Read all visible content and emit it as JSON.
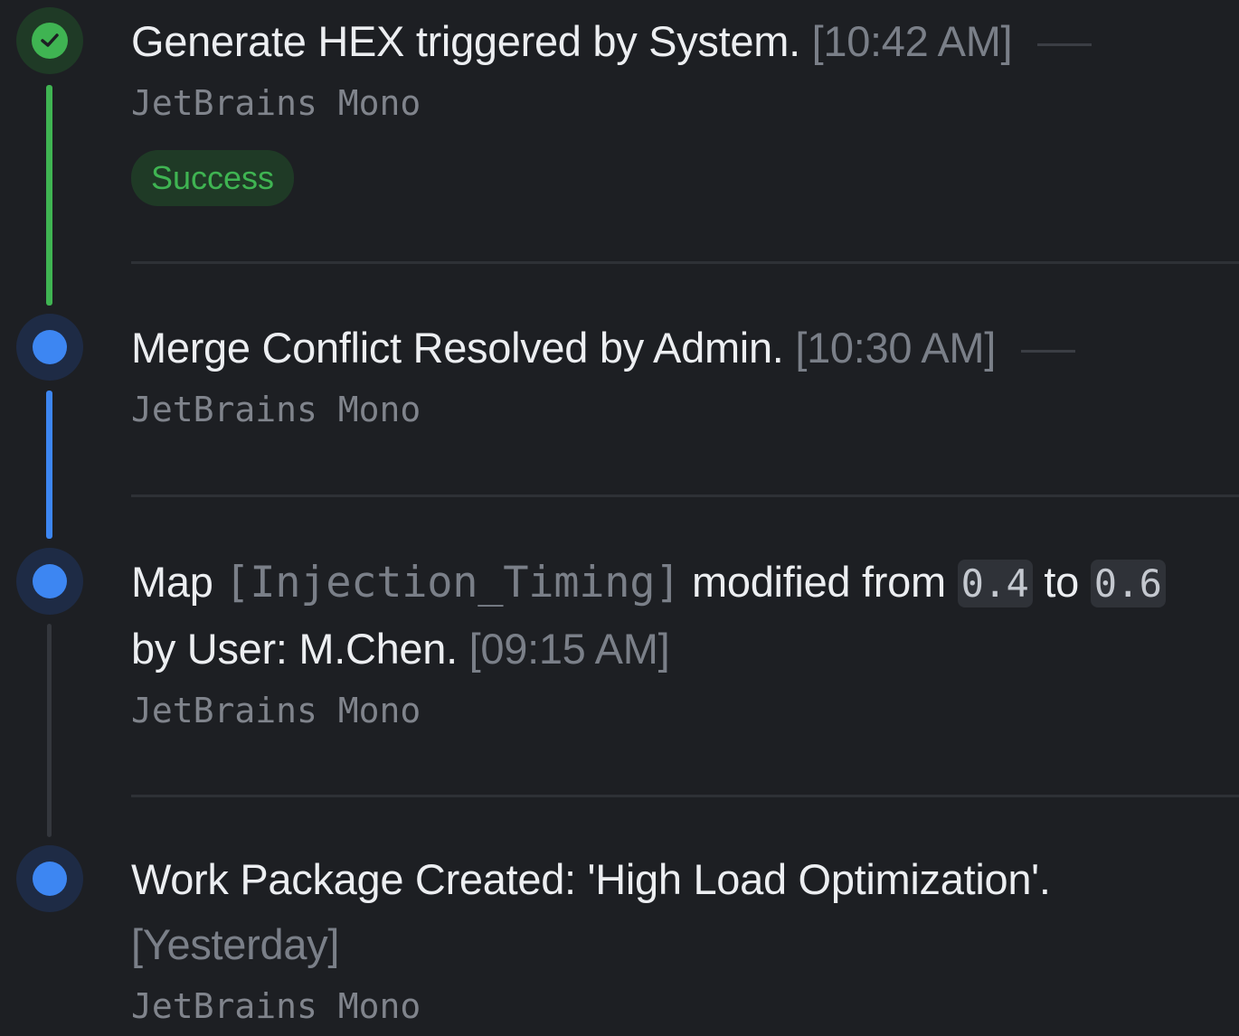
{
  "events": [
    {
      "title": "Generate HEX triggered by System.",
      "time": "[10:42 AM]",
      "subtitle": "JetBrains Mono",
      "badge": "Success",
      "status": "success"
    },
    {
      "title": "Merge Conflict Resolved by Admin.",
      "time": "[10:30 AM]",
      "subtitle": "JetBrains Mono",
      "status": "info"
    },
    {
      "title_prefix": "Map",
      "map_name": "[Injection_Timing]",
      "title_mid1": "modified from",
      "from_value": "0.4",
      "title_mid2": "to",
      "to_value": "0.6",
      "title_suffix": "by User: M.Chen.",
      "time": "[09:15 AM]",
      "subtitle": "JetBrains Mono",
      "status": "info"
    },
    {
      "title": "Work Package Created: 'High Load Optimization'.",
      "time": "[Yesterday]",
      "subtitle": "JetBrains Mono",
      "status": "info"
    }
  ],
  "colors": {
    "success": "#3fb452",
    "info": "#3d86f2",
    "background": "#1d1f23",
    "muted": "#7a7f88"
  },
  "icons": {
    "success_node": "check-icon",
    "info_node": "dot-icon"
  }
}
